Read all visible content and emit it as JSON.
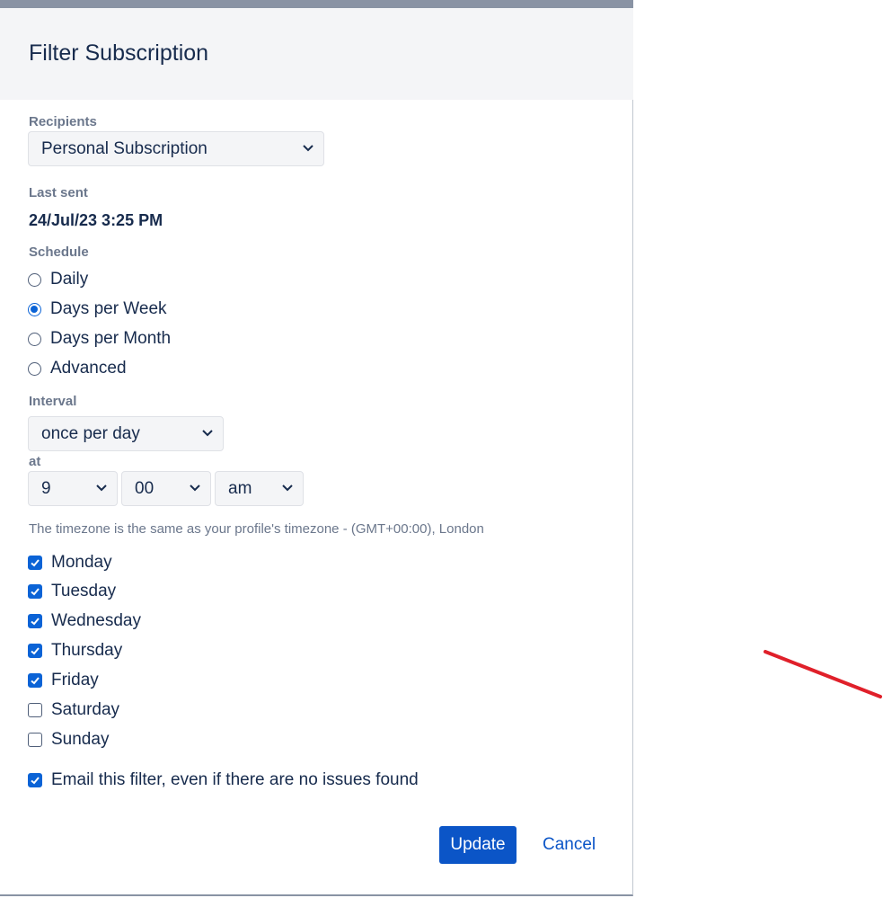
{
  "dialog": {
    "title": "Filter Subscription",
    "recipients_label": "Recipients",
    "recipients_value": "Personal Subscription",
    "last_sent_label": "Last sent",
    "last_sent_value": "24/Jul/23 3:25 PM",
    "schedule_label": "Schedule",
    "schedule_options": [
      {
        "label": "Daily",
        "selected": false
      },
      {
        "label": "Days per Week",
        "selected": true
      },
      {
        "label": "Days per Month",
        "selected": false
      },
      {
        "label": "Advanced",
        "selected": false
      }
    ],
    "interval_label": "Interval",
    "interval_value": "once per day",
    "at_label": "at",
    "hour_value": "9",
    "minute_value": "00",
    "ampm_value": "am",
    "timezone_hint": "The timezone is the same as your profile's timezone - (GMT+00:00), London",
    "days": [
      {
        "label": "Monday",
        "checked": true
      },
      {
        "label": "Tuesday",
        "checked": true
      },
      {
        "label": "Wednesday",
        "checked": true
      },
      {
        "label": "Thursday",
        "checked": true
      },
      {
        "label": "Friday",
        "checked": true
      },
      {
        "label": "Saturday",
        "checked": false
      },
      {
        "label": "Sunday",
        "checked": false
      }
    ],
    "email_empty_label": "Email this filter, even if there are no issues found",
    "email_empty_checked": true,
    "update_label": "Update",
    "cancel_label": "Cancel"
  },
  "colors": {
    "accent": "#0b55c7",
    "annotation": "#e0202a"
  },
  "icons": {
    "select_chevron": "chevron-down-icon",
    "checkbox_check": "check-icon"
  }
}
